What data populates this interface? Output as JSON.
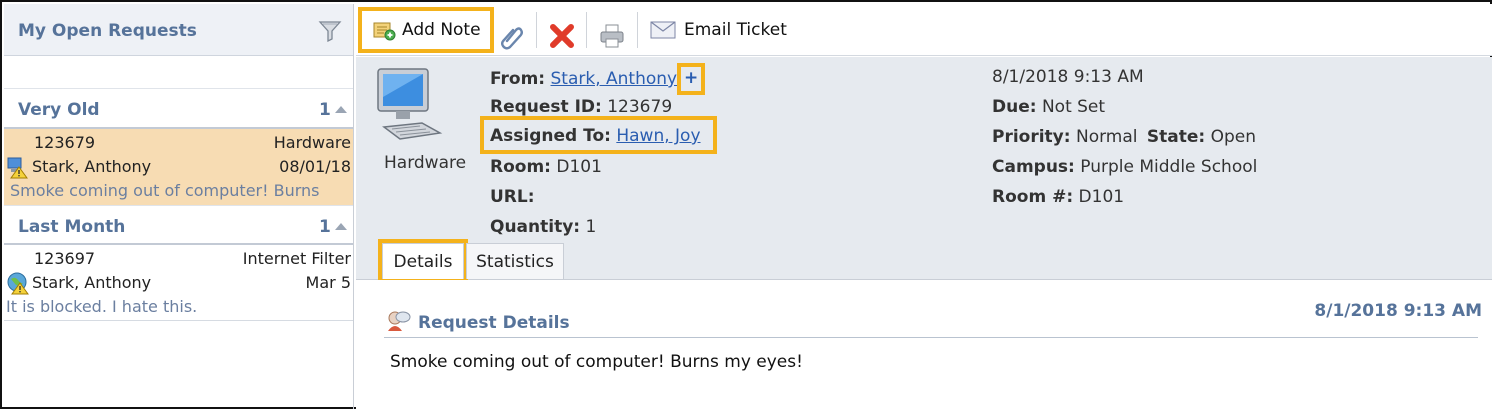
{
  "left": {
    "title": "My Open Requests",
    "groups": [
      {
        "title": "Very Old",
        "count": "1",
        "requests": [
          {
            "id": "123679",
            "category": "Hardware",
            "name": "Stark, Anthony",
            "date": "08/01/18",
            "description": "Smoke coming out of computer! Burns"
          }
        ]
      },
      {
        "title": "Last Month",
        "count": "1",
        "requests": [
          {
            "id": "123697",
            "category": "Internet Filter",
            "name": "Stark, Anthony",
            "date": "Mar 5",
            "description": "It is blocked. I hate this."
          }
        ]
      }
    ]
  },
  "toolbar": {
    "add_note": "Add Note",
    "email_ticket": "Email Ticket",
    "icons": [
      "add-note-icon",
      "attach-icon",
      "delete-icon",
      "print-icon",
      "email-icon"
    ]
  },
  "ticket": {
    "category": "Hardware",
    "from_label": "From:",
    "from_value": "Stark, Anthony",
    "plus": "+",
    "request_id_label": "Request ID:",
    "request_id": "123679",
    "assigned_label": "Assigned To:",
    "assigned_value": "Hawn, Joy",
    "room_label": "Room:",
    "room": "D101",
    "url_label": "URL:",
    "quantity_label": "Quantity:",
    "quantity": "1",
    "datetime": "8/1/2018 9:13 AM",
    "due_label": "Due:",
    "due": "Not Set",
    "priority_label": "Priority:",
    "priority": "Normal",
    "state_label": "State:",
    "state": "Open",
    "campus_label": "Campus:",
    "campus": "Purple Middle School",
    "roomnum_label": "Room #:",
    "roomnum": "D101"
  },
  "tabs": [
    "Details",
    "Statistics"
  ],
  "details": {
    "title": "Request Details",
    "date": "8/1/2018 9:13 AM",
    "text": "Smoke coming out of computer! Burns my eyes!"
  },
  "colors": {
    "highlight": "#f4b21b",
    "selected_row": "#f7dcb3",
    "heading": "#56739a",
    "link": "#2a5db0"
  }
}
